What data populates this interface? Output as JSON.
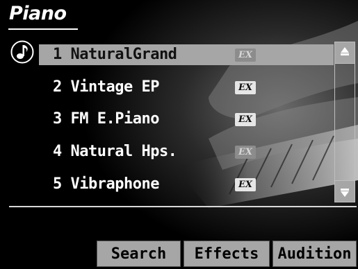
{
  "screen": {
    "title": "Piano"
  },
  "tones": [
    {
      "label": "1 NaturalGrand",
      "ex": "EX",
      "selected": true
    },
    {
      "label": "2 Vintage EP",
      "ex": "EX"
    },
    {
      "label": "3 FM E.Piano",
      "ex": "EX"
    },
    {
      "label": "4 Natural Hps.",
      "ex": "EX"
    },
    {
      "label": "5 Vibraphone",
      "ex": "EX"
    }
  ],
  "buttons": {
    "search": "Search",
    "effects": "Effects",
    "audition": "Audition"
  },
  "icons": {
    "tone": "music-note-icon",
    "up": "scroll-up-arrow-icon",
    "down": "scroll-down-arrow-icon"
  }
}
